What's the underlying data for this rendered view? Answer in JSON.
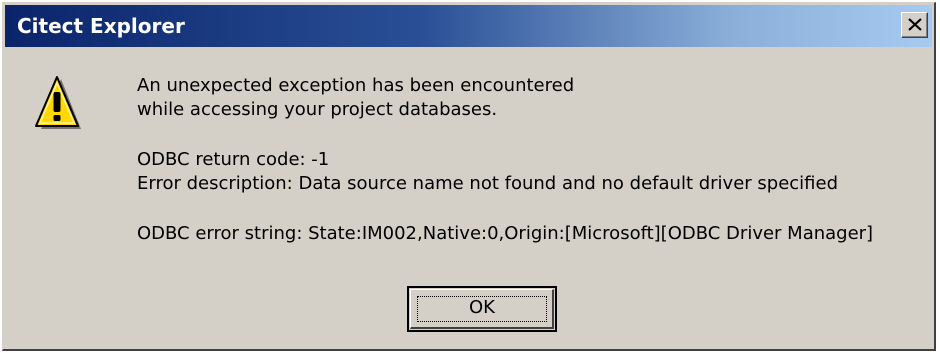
{
  "window": {
    "title": "Citect Explorer",
    "close_icon": "close-icon"
  },
  "message": {
    "icon": "warning-icon",
    "line1": "An unexpected exception has been encountered",
    "line2": "while accessing your project databases.",
    "return_code": "ODBC return code: -1",
    "error_description": "Error description: Data source name not found and no default driver specified",
    "error_string": "ODBC error string: State:IM002,Native:0,Origin:[Microsoft][ODBC Driver Manager]"
  },
  "buttons": {
    "ok_label": "OK"
  },
  "colors": {
    "titlebar_start": "#0a246a",
    "titlebar_end": "#a6caf0",
    "dialog_face": "#d4d0c8",
    "warning_yellow": "#ffd800"
  }
}
